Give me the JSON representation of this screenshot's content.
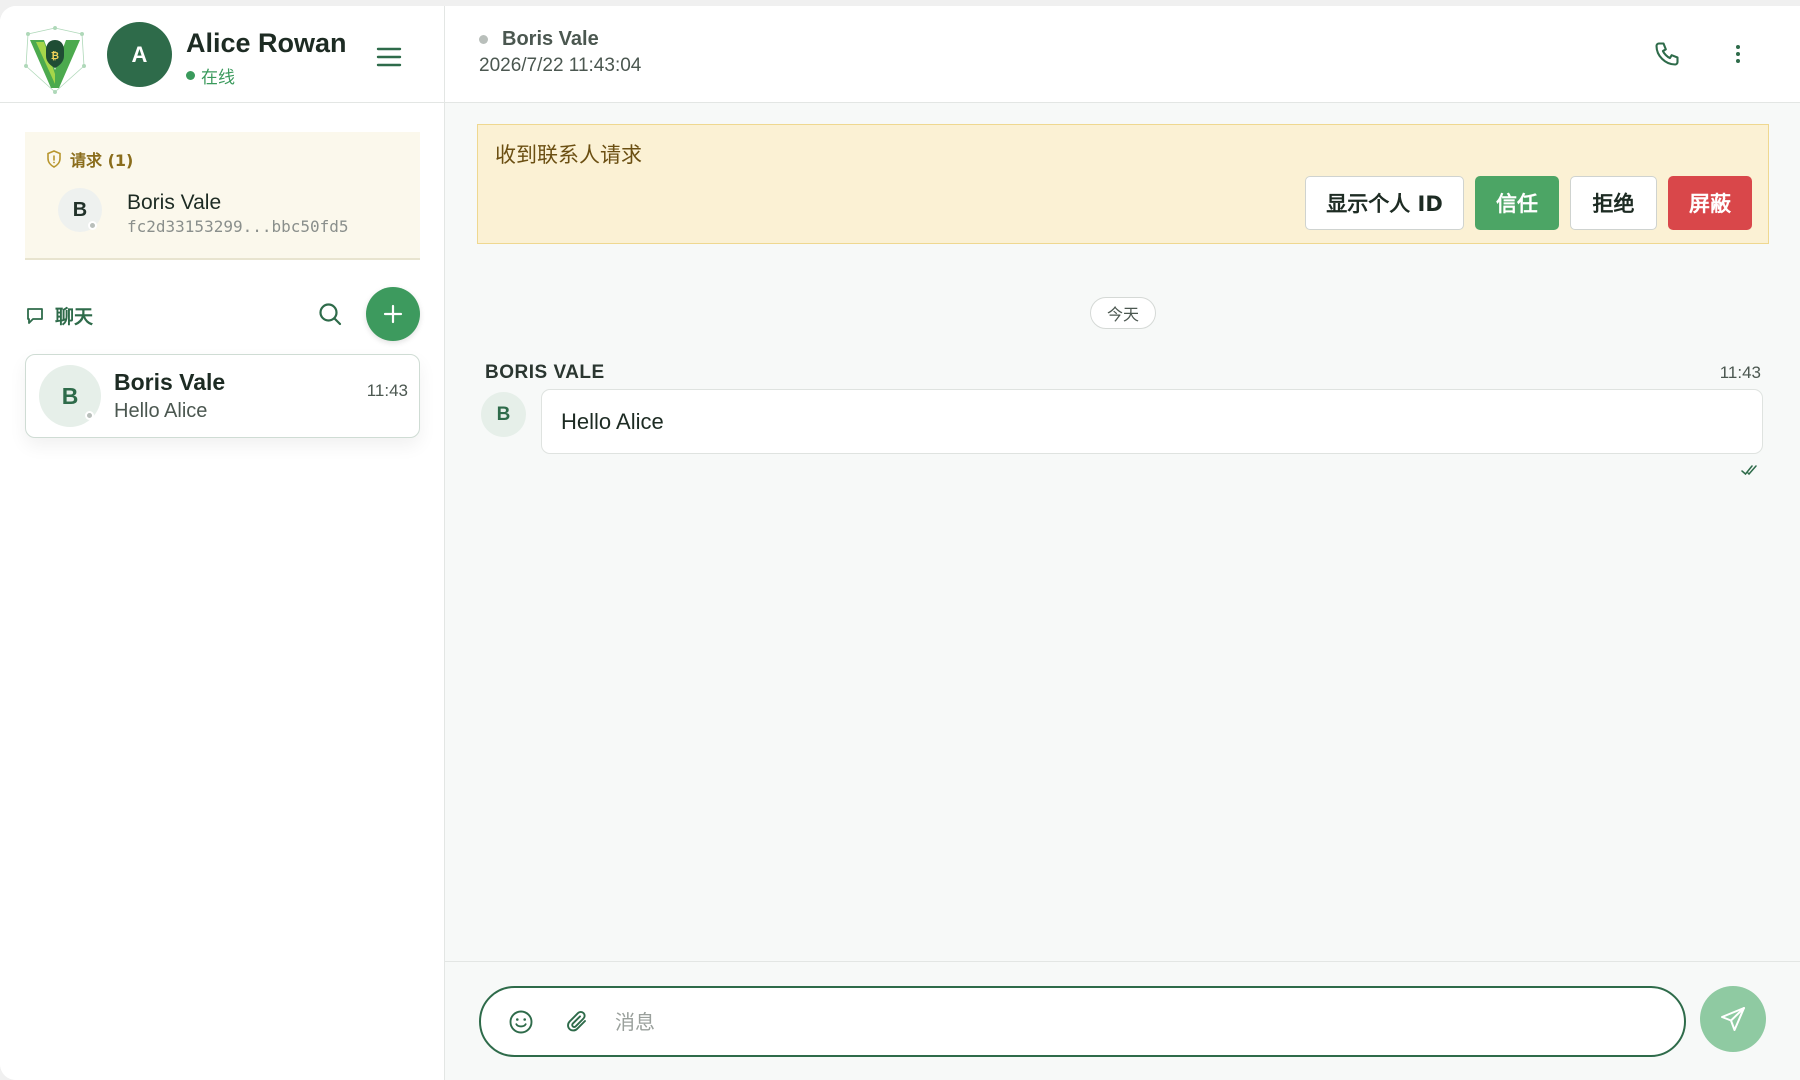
{
  "colors": {
    "brand_green": "#2e6b4a",
    "accent_green": "#3d9a5e",
    "online_green": "#3a9a5c",
    "danger_red": "#d9474a",
    "request_bg": "#fbf1d4",
    "offline_gray": "#b9bfbb"
  },
  "sidebar": {
    "logo_icon": "shield-v-logo",
    "user": {
      "initial": "A",
      "name": "Alice Rowan",
      "status": "在线"
    },
    "requests": {
      "title": "请求 (1)",
      "items": [
        {
          "initial": "B",
          "name": "Boris Vale",
          "id": "fc2d33153299...bbc50fd5"
        }
      ]
    },
    "chats": {
      "title": "聊天",
      "items": [
        {
          "initial": "B",
          "name": "Boris Vale",
          "preview": "Hello Alice",
          "time": "11:43"
        }
      ]
    }
  },
  "conversation": {
    "header": {
      "name": "Boris Vale",
      "datetime": "2026/7/22 11:43:04"
    },
    "banner": {
      "title": "收到联系人请求",
      "show_id_label": "显示个人 ID",
      "trust_label": "信任",
      "reject_label": "拒绝",
      "block_label": "屏蔽"
    },
    "day_label": "今天",
    "messages": [
      {
        "sender": "BORIS VALE",
        "initial": "B",
        "time": "11:43",
        "text": "Hello Alice"
      }
    ],
    "composer": {
      "placeholder": "消息"
    }
  }
}
